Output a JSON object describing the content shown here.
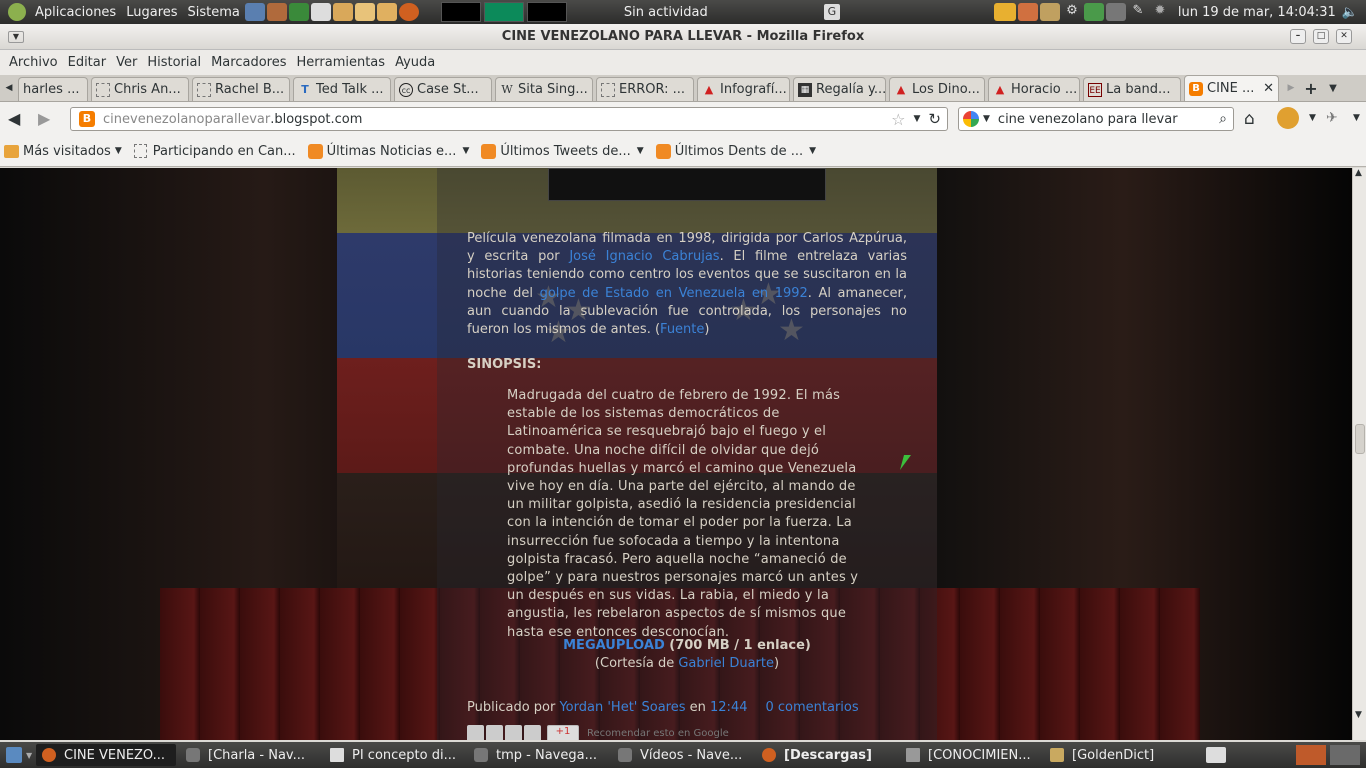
{
  "top_panel": {
    "menus": [
      "Aplicaciones",
      "Lugares",
      "Sistema"
    ],
    "status": "Sin actividad",
    "clock": "lun 19 de mar, 14:04:31"
  },
  "window": {
    "title": "CINE VENEZOLANO PARA LLEVAR - Mozilla Firefox"
  },
  "menubar": [
    "Archivo",
    "Editar",
    "Ver",
    "Historial",
    "Marcadores",
    "Herramientas",
    "Ayuda"
  ],
  "tabs": [
    {
      "label": "harles ...",
      "icon": "page-icon"
    },
    {
      "label": "Chris An...",
      "icon": "page-icon"
    },
    {
      "label": "Rachel B...",
      "icon": "page-icon"
    },
    {
      "label": "Ted Talk ...",
      "icon": "ted-icon"
    },
    {
      "label": "Case St...",
      "icon": "cc-icon"
    },
    {
      "label": "Sita Sing...",
      "icon": "wikipedia-icon"
    },
    {
      "label": "ERROR: ...",
      "icon": "page-icon"
    },
    {
      "label": "Infografí...",
      "icon": "flame-icon"
    },
    {
      "label": "Regalía y...",
      "icon": "grid-icon"
    },
    {
      "label": "Los Dino...",
      "icon": "flame-icon"
    },
    {
      "label": "Horacio ...",
      "icon": "flame-icon"
    },
    {
      "label": "La band...",
      "icon": "ee-icon"
    },
    {
      "label": "CINE ...",
      "icon": "blogger-icon"
    }
  ],
  "url": {
    "domain_prefix": "cinevenezolanoparallevar",
    "domain_suffix": ".blogspot.com"
  },
  "search": {
    "value": "cine venezolano para llevar"
  },
  "bookmarks": [
    {
      "label": "Más visitados",
      "dropdown": true
    },
    {
      "label": "Participando en Can...",
      "dropdown": false
    },
    {
      "label": "Últimas Noticias e...",
      "dropdown": true
    },
    {
      "label": "Últimos Tweets de...",
      "dropdown": true
    },
    {
      "label": "Últimos Dents de ...",
      "dropdown": true
    }
  ],
  "post": {
    "intro_1": "Película venezolana filmada en 1998, dirigida por Carlos Azpúrua, y escrita por ",
    "intro_link_1": "José Ignacio Cabrujas",
    "intro_2": ". El filme entrelaza varias historias teniendo como centro los eventos que se suscitaron en la noche del ",
    "intro_link_2": "golpe de Estado en Venezuela en 1992",
    "intro_3": ". Al amanecer, aun cuando la sublevación fue controlada, los personajes no fueron los mismos de antes. (",
    "intro_link_3": "Fuente",
    "intro_4": ")",
    "sinopsis_heading": "SINOPSIS:",
    "sinopsis": "Madrugada del cuatro de febrero de 1992. El más estable de los sistemas democráticos de Latinoamérica se resquebrajó bajo el fuego y el combate. Una noche difícil de olvidar que dejó profundas huellas y marcó el camino que Venezuela vive hoy en día. Una parte del ejército, al mando de un militar golpista, asedió la residencia presidencial con la intención de tomar el poder por la fuerza. La insurrección fue sofocada a tiempo y la intentona golpista fracasó. Pero aquella noche “amaneció de golpe” y para nuestros personajes marcó un antes y un después en sus vidas. La rabia, el miedo y la angustia, les rebelaron aspectos de sí mismos que hasta ese entonces desconocían.",
    "download_link": "MEGAUPLOAD",
    "download_info": " (700 MB / 1 enlace)",
    "courtesy_prefix": "(Cortesía de ",
    "courtesy_link": "Gabriel Duarte",
    "courtesy_suffix": ")",
    "footer_by": "Publicado por ",
    "footer_author": "Yordan 'Het' Soares",
    "footer_en": " en ",
    "footer_time": "12:44",
    "footer_comments": "0 comentarios",
    "share_text": "Recomendar esto en Google"
  },
  "taskbar": [
    {
      "label": "CINE VENEZO...",
      "selected": true
    },
    {
      "label": "[Charla - Nav...",
      "selected": false
    },
    {
      "label": "PI concepto di...",
      "selected": false
    },
    {
      "label": "tmp - Navega...",
      "selected": false
    },
    {
      "label": "Vídeos - Nave...",
      "selected": false
    },
    {
      "label": "[Descargas]",
      "selected": false
    },
    {
      "label": "[CONOCIMIEN...",
      "selected": false
    },
    {
      "label": "[GoldenDict]",
      "selected": false
    }
  ]
}
